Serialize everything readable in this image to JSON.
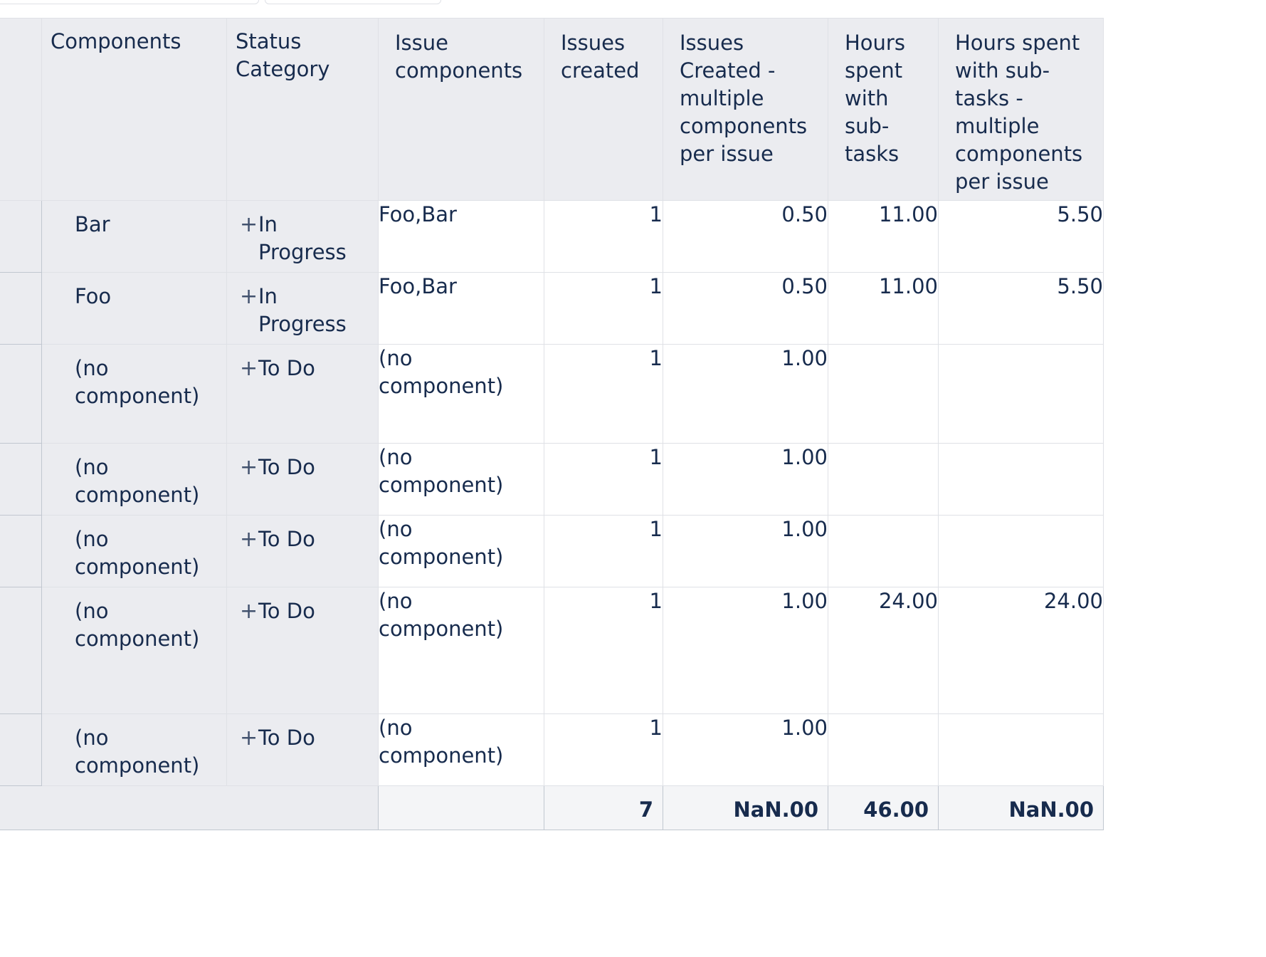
{
  "table": {
    "headers": {
      "components": "Components",
      "status_category": "Status Category",
      "issue_components": "Issue components",
      "issues_created": "Issues created",
      "issues_created_multi": "Issues Created - multiple components per issue",
      "hours_spent": "Hours spent with sub-tasks",
      "hours_spent_multi": "Hours spent with sub-tasks - multiple components per issue"
    },
    "rows": [
      {
        "component": "Bar",
        "status": "In Progress",
        "issue_components": "Foo,Bar",
        "issues_created": "1",
        "issues_multi": "0.50",
        "hours": "11.00",
        "hours_multi": "5.50"
      },
      {
        "component": "Foo",
        "status": "In Progress",
        "issue_components": "Foo,Bar",
        "issues_created": "1",
        "issues_multi": "0.50",
        "hours": "11.00",
        "hours_multi": "5.50"
      },
      {
        "component": "(no component)",
        "status": "To Do",
        "issue_components": "(no component)",
        "issues_created": "1",
        "issues_multi": "1.00",
        "hours": "",
        "hours_multi": ""
      },
      {
        "component": "(no component)",
        "status": "To Do",
        "issue_components": "(no component)",
        "issues_created": "1",
        "issues_multi": "1.00",
        "hours": "",
        "hours_multi": ""
      },
      {
        "component": "(no component)",
        "status": "To Do",
        "issue_components": "(no component)",
        "issues_created": "1",
        "issues_multi": "1.00",
        "hours": "",
        "hours_multi": ""
      },
      {
        "component": "(no component)",
        "status": "To Do",
        "issue_components": "(no component)",
        "issues_created": "1",
        "issues_multi": "1.00",
        "hours": "24.00",
        "hours_multi": "24.00"
      },
      {
        "component": "(no component)",
        "status": "To Do",
        "issue_components": "(no component)",
        "issues_created": "1",
        "issues_multi": "1.00",
        "hours": "",
        "hours_multi": ""
      }
    ],
    "totals": {
      "issues_created": "7",
      "issues_multi": "NaN.00",
      "hours": "46.00",
      "hours_multi": "NaN.00"
    },
    "expand_icon": "plus-icon"
  }
}
